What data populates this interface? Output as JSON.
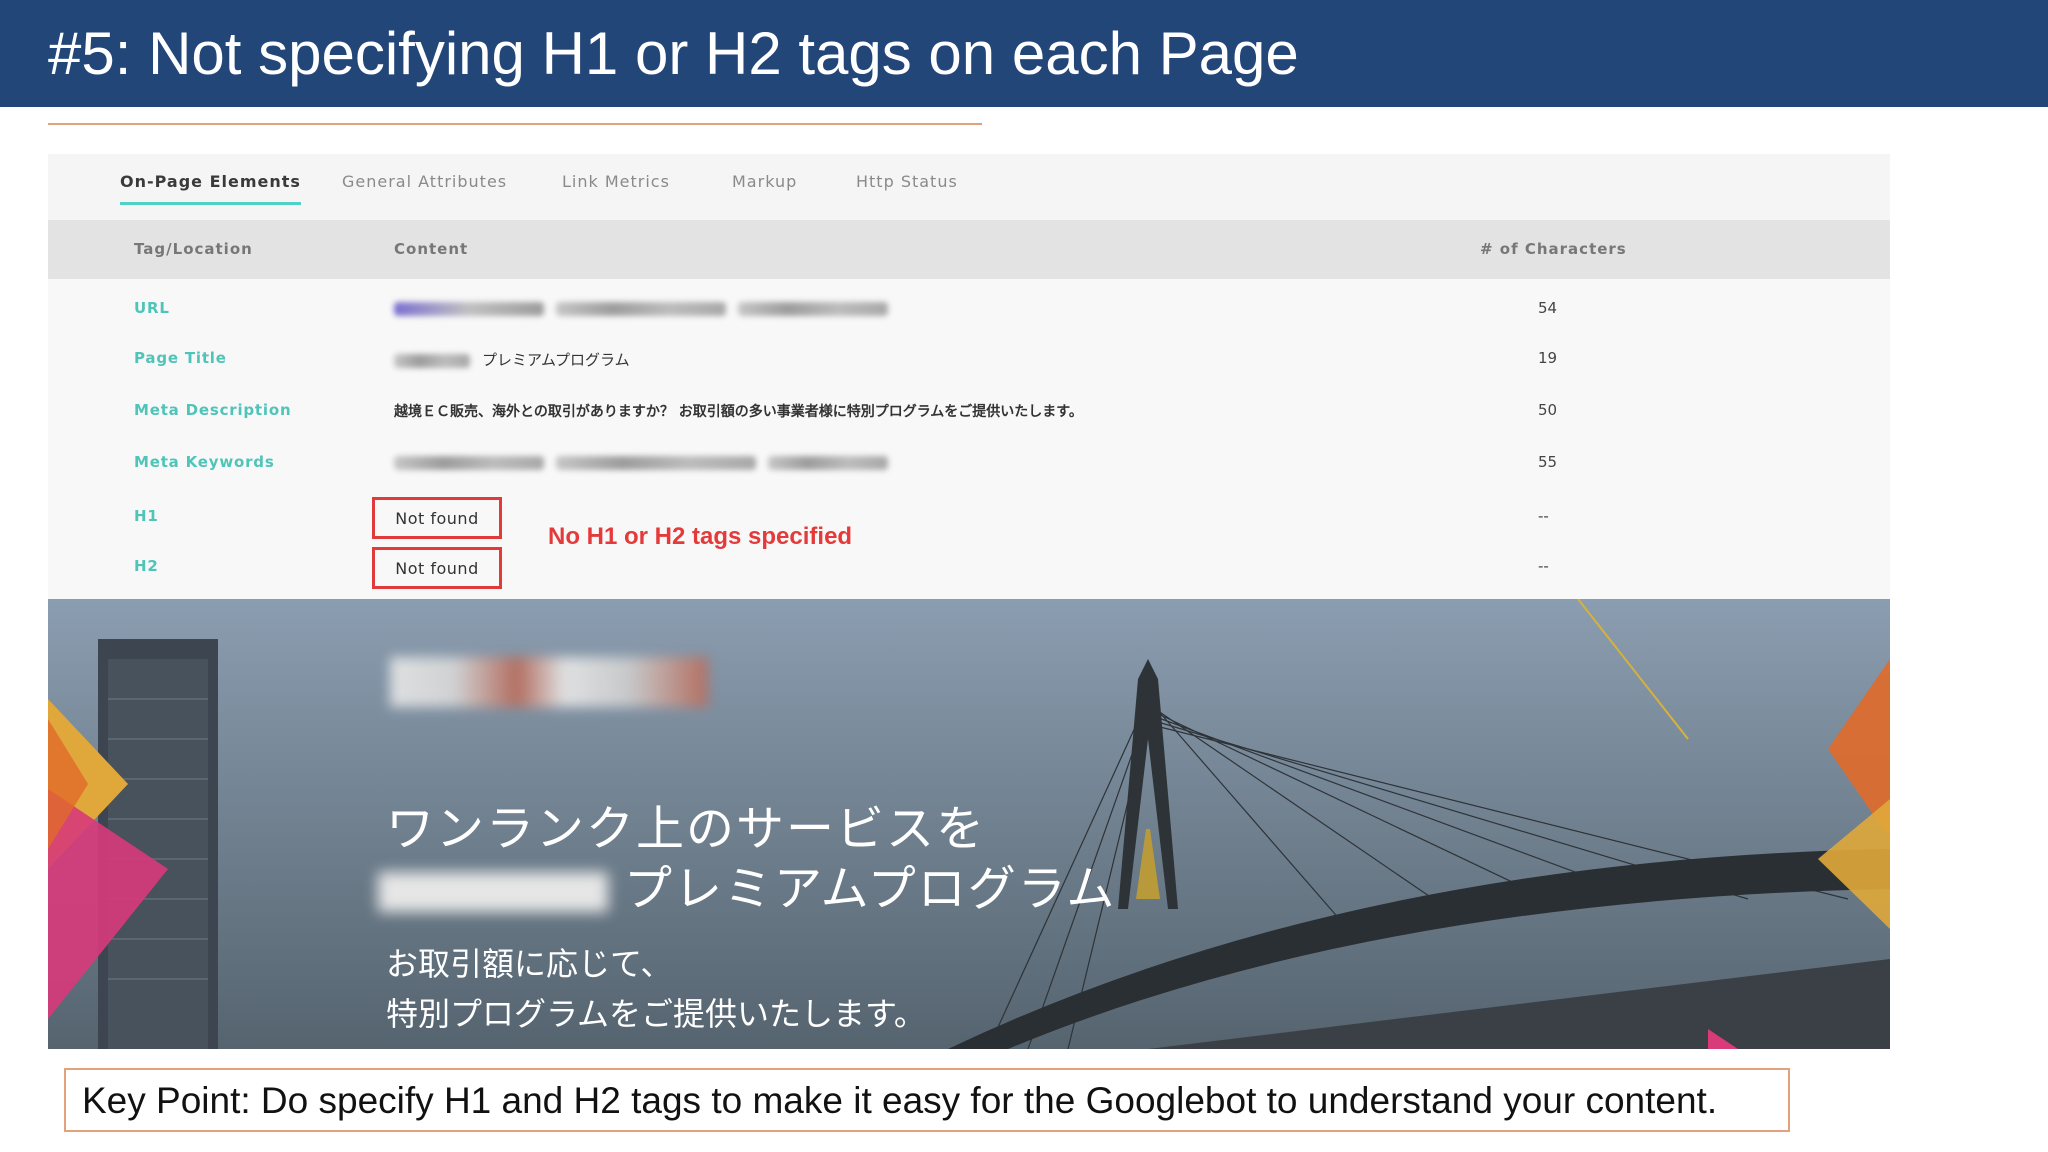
{
  "slide": {
    "title": "#5: Not specifying H1 or H2 tags on each Page"
  },
  "tabs": [
    {
      "label": "On-Page Elements",
      "active": true
    },
    {
      "label": "General Attributes",
      "active": false
    },
    {
      "label": "Link Metrics",
      "active": false
    },
    {
      "label": "Markup",
      "active": false
    },
    {
      "label": "Http Status",
      "active": false
    }
  ],
  "table": {
    "headers": {
      "tag": "Tag/Location",
      "content": "Content",
      "count": "# of Characters"
    },
    "rows": [
      {
        "tag": "URL",
        "content": "",
        "count": "54"
      },
      {
        "tag": "Page Title",
        "content": "プレミアムプログラム",
        "count": "19"
      },
      {
        "tag": "Meta Description",
        "content": "越境ＥＣ販売、海外との取引がありますか？ お取引額の多い事業者様に特別プログラムをご提供いたします。",
        "count": "50"
      },
      {
        "tag": "Meta Keywords",
        "content": "",
        "count": "55"
      },
      {
        "tag": "H1",
        "content": "Not found",
        "count": "--"
      },
      {
        "tag": "H2",
        "content": "Not found",
        "count": "--"
      }
    ]
  },
  "annotation": "No H1 or H2 tags specified",
  "hero": {
    "line1": "ワンランク上のサービスを",
    "line2": "プレミアムプログラム",
    "line3": "お取引額に応じて、",
    "line4": "特別プログラムをご提供いたします。"
  },
  "key_point": "Key Point: Do specify H1 and H2 tags to make it easy for the Googlebot to understand your content.",
  "colors": {
    "header_bg": "#234679",
    "accent_teal": "#4fc4b8",
    "highlight_red": "#e03a3a",
    "rule_orange": "#e0a27a"
  }
}
